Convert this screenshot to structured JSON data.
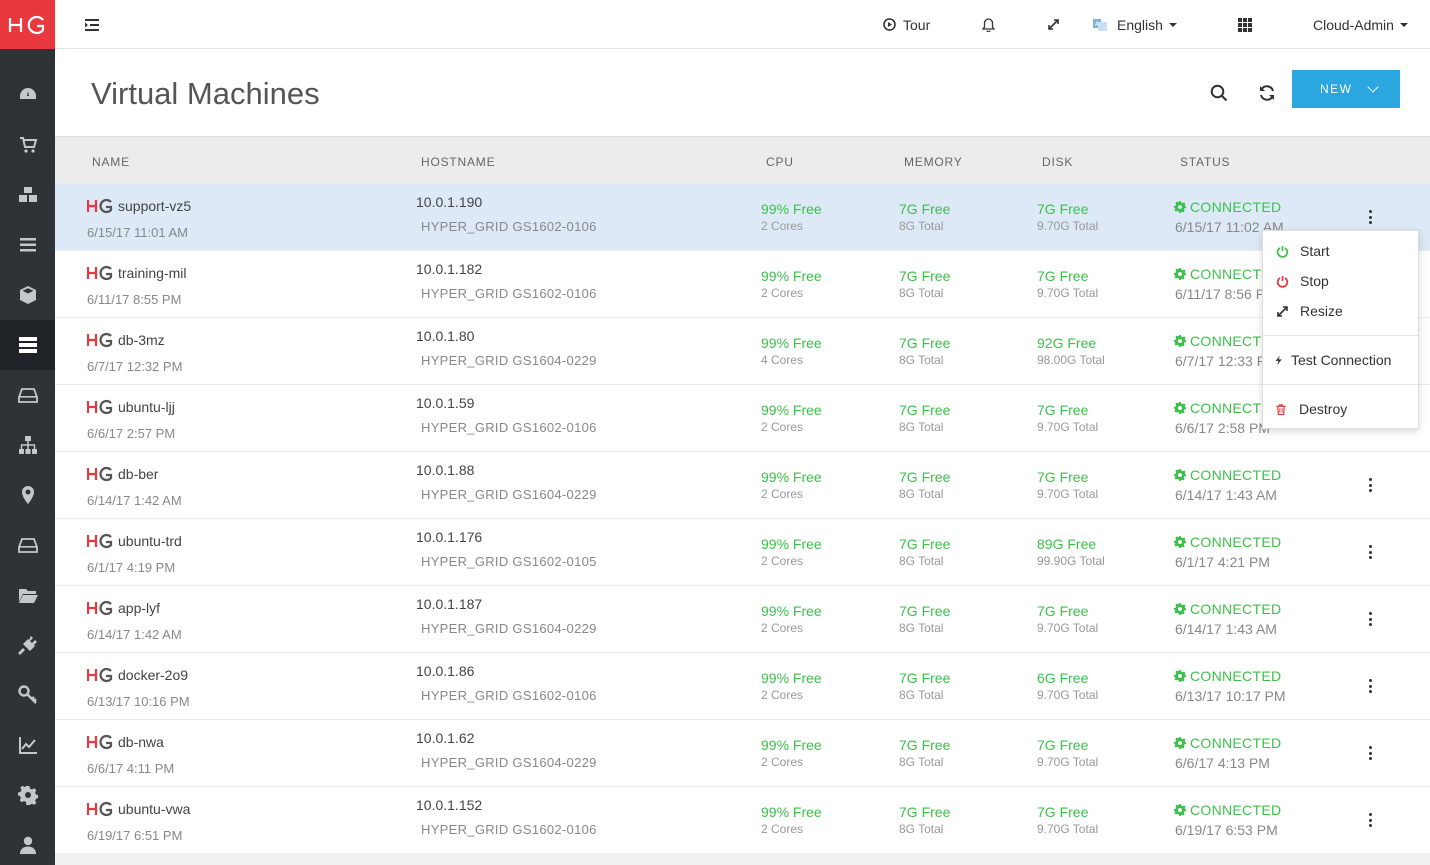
{
  "app": {
    "logo_text": "HG"
  },
  "topbar": {
    "tour_label": "Tour",
    "language_label": "English",
    "user_label": "Cloud-Admin"
  },
  "header": {
    "title": "Virtual Machines",
    "new_button_label": "NEW"
  },
  "columns": {
    "name": "NAME",
    "hostname": "HOSTNAME",
    "cpu": "CPU",
    "memory": "MEMORY",
    "disk": "DISK",
    "status": "STATUS"
  },
  "rows": [
    {
      "name": "support-vz5",
      "created": "6/15/17 11:01 AM",
      "ip": "10.0.1.190",
      "host": "HYPER_GRID GS1602-0106",
      "cpu": "99% Free",
      "cores": "2 Cores",
      "mem": "7G Free",
      "mem_total": "8G Total",
      "disk": "7G Free",
      "disk_total": "9.70G Total",
      "status": "CONNECTED",
      "status_date": "6/15/17 11:02 AM"
    },
    {
      "name": "training-mil",
      "created": "6/11/17 8:55 PM",
      "ip": "10.0.1.182",
      "host": "HYPER_GRID GS1602-0106",
      "cpu": "99% Free",
      "cores": "2 Cores",
      "mem": "7G Free",
      "mem_total": "8G Total",
      "disk": "7G Free",
      "disk_total": "9.70G Total",
      "status": "CONNECTED",
      "status_date": "6/11/17 8:56 PM"
    },
    {
      "name": "db-3mz",
      "created": "6/7/17 12:32 PM",
      "ip": "10.0.1.80",
      "host": "HYPER_GRID GS1604-0229",
      "cpu": "99% Free",
      "cores": "4 Cores",
      "mem": "7G Free",
      "mem_total": "8G Total",
      "disk": "92G Free",
      "disk_total": "98.00G Total",
      "status": "CONNECTED",
      "status_date": "6/7/17 12:33 PM"
    },
    {
      "name": "ubuntu-ljj",
      "created": "6/6/17 2:57 PM",
      "ip": "10.0.1.59",
      "host": "HYPER_GRID GS1602-0106",
      "cpu": "99% Free",
      "cores": "2 Cores",
      "mem": "7G Free",
      "mem_total": "8G Total",
      "disk": "7G Free",
      "disk_total": "9.70G Total",
      "status": "CONNECTED",
      "status_date": "6/6/17 2:58 PM"
    },
    {
      "name": "db-ber",
      "created": "6/14/17 1:42 AM",
      "ip": "10.0.1.88",
      "host": "HYPER_GRID GS1604-0229",
      "cpu": "99% Free",
      "cores": "2 Cores",
      "mem": "7G Free",
      "mem_total": "8G Total",
      "disk": "7G Free",
      "disk_total": "9.70G Total",
      "status": "CONNECTED",
      "status_date": "6/14/17 1:43 AM"
    },
    {
      "name": "ubuntu-trd",
      "created": "6/1/17 4:19 PM",
      "ip": "10.0.1.176",
      "host": "HYPER_GRID GS1602-0105",
      "cpu": "99% Free",
      "cores": "2 Cores",
      "mem": "7G Free",
      "mem_total": "8G Total",
      "disk": "89G Free",
      "disk_total": "99.90G Total",
      "status": "CONNECTED",
      "status_date": "6/1/17 4:21 PM"
    },
    {
      "name": "app-lyf",
      "created": "6/14/17 1:42 AM",
      "ip": "10.0.1.187",
      "host": "HYPER_GRID GS1604-0229",
      "cpu": "99% Free",
      "cores": "2 Cores",
      "mem": "7G Free",
      "mem_total": "8G Total",
      "disk": "7G Free",
      "disk_total": "9.70G Total",
      "status": "CONNECTED",
      "status_date": "6/14/17 1:43 AM"
    },
    {
      "name": "docker-2o9",
      "created": "6/13/17 10:16 PM",
      "ip": "10.0.1.86",
      "host": "HYPER_GRID GS1602-0106",
      "cpu": "99% Free",
      "cores": "2 Cores",
      "mem": "7G Free",
      "mem_total": "8G Total",
      "disk": "6G Free",
      "disk_total": "9.70G Total",
      "status": "CONNECTED",
      "status_date": "6/13/17 10:17 PM"
    },
    {
      "name": "db-nwa",
      "created": "6/6/17 4:11 PM",
      "ip": "10.0.1.62",
      "host": "HYPER_GRID GS1604-0229",
      "cpu": "99% Free",
      "cores": "2 Cores",
      "mem": "7G Free",
      "mem_total": "8G Total",
      "disk": "7G Free",
      "disk_total": "9.70G Total",
      "status": "CONNECTED",
      "status_date": "6/6/17 4:13 PM"
    },
    {
      "name": "ubuntu-vwa",
      "created": "6/19/17 6:51 PM",
      "ip": "10.0.1.152",
      "host": "HYPER_GRID GS1602-0106",
      "cpu": "99% Free",
      "cores": "2 Cores",
      "mem": "7G Free",
      "mem_total": "8G Total",
      "disk": "7G Free",
      "disk_total": "9.70G Total",
      "status": "CONNECTED",
      "status_date": "6/19/17 6:53 PM"
    }
  ],
  "action_menu": {
    "start": "Start",
    "stop": "Stop",
    "resize": "Resize",
    "test_connection": "Test Connection",
    "destroy": "Destroy"
  },
  "colors": {
    "brand_red": "#e8383d",
    "accent_blue": "#2aa6e0",
    "status_green": "#3bc14a",
    "sidebar_bg": "#2f3338",
    "selected_row": "#dde9f7"
  },
  "icons": {
    "sidebar": [
      "dashboard-icon",
      "cart-icon",
      "cubes-icon",
      "list-icon",
      "cube-icon",
      "server-icon",
      "hdd-icon",
      "sitemap-icon",
      "map-marker-icon",
      "drive-icon",
      "folder-icon",
      "plug-icon",
      "key-icon",
      "chart-icon",
      "gear-icon",
      "user-icon"
    ]
  }
}
